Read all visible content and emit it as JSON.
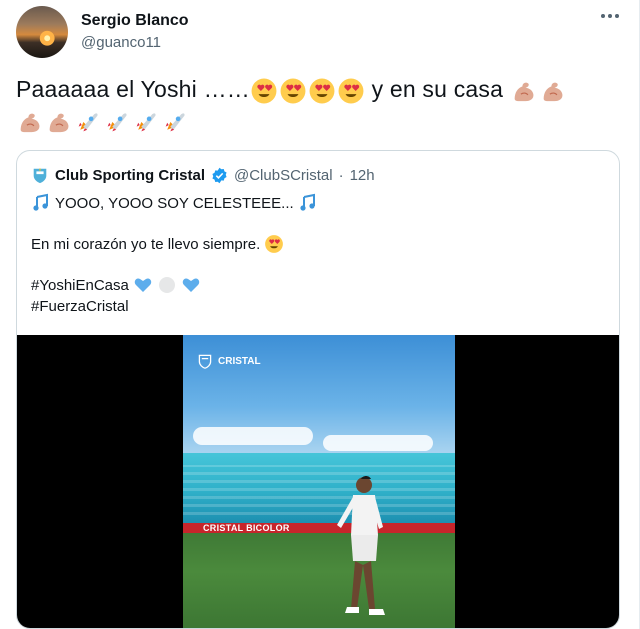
{
  "tweet": {
    "author_name": "Sergio Blanco",
    "author_handle": "@guanco11",
    "text_main": "Paaaaaa el Yoshi ……",
    "text_after": "y en su casa",
    "emojis_line1": [
      "heart-eyes",
      "heart-eyes",
      "heart-eyes",
      "heart-eyes"
    ],
    "emojis_line1_end": [
      "flexed-biceps",
      "flexed-biceps"
    ],
    "emojis_line2": [
      "flexed-biceps",
      "flexed-biceps",
      "rocket",
      "rocket",
      "rocket",
      "rocket"
    ]
  },
  "quote": {
    "name": "Club Sporting Cristal",
    "handle": "@ClubSCristal",
    "separator": "·",
    "time": "12h",
    "line1": "YOOO, YOOO SOY CELESTEEE...",
    "line2": "En mi corazón yo te llevo siempre.",
    "hashtag1": "#YoshiEnCasa",
    "hashtag2": "#FuerzaCristal",
    "emoji_notes": "musical-notes",
    "emoji_hearts": [
      "blue-heart",
      "white-circle",
      "blue-heart"
    ]
  },
  "media": {
    "watermark": "CRISTAL",
    "banner_text": "CRISTAL   BICOLOR",
    "colors": {
      "sky": "#3d8fd6",
      "seats": "#2fb0c9",
      "pitch": "#4b8a3c",
      "banner": "#c6252b"
    }
  },
  "colors": {
    "text": "#0f1419",
    "muted": "#536471",
    "verified": "#1d9bf0",
    "border": "#cfd9de"
  }
}
